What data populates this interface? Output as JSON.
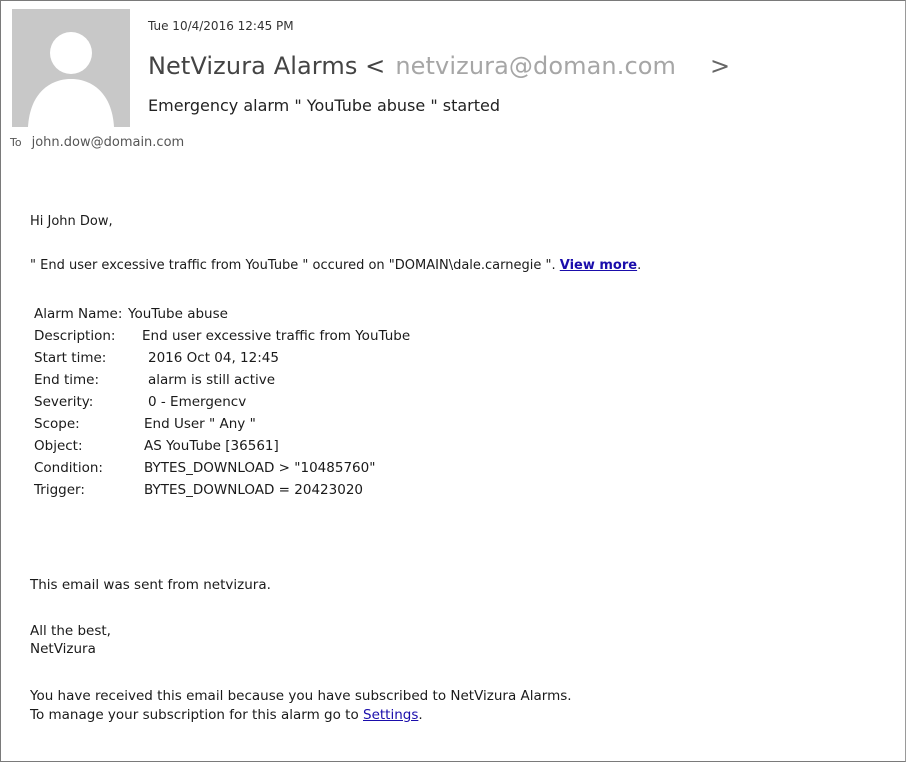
{
  "header": {
    "sent_time": "Tue 10/4/2016 12:45 PM",
    "sender_name": "NetVizura Alarms <",
    "sender_email": "netvizura@doman.com",
    "sender_close": ">",
    "subject": "Emergency alarm \" YouTube abuse \" started",
    "to_label": "To",
    "to_address": "john.dow@domain.com"
  },
  "body": {
    "greeting": "Hi John Dow,",
    "intro_quote": "\" End user excessive traffic from YouTube \"",
    "intro_middle": " occured on \"DOMAIN\\dale.carnegie \". ",
    "view_more": "View more",
    "intro_end": ".",
    "details": [
      {
        "key": "Alarm Name:",
        "value": "YouTube abuse"
      },
      {
        "key": "Description:",
        "value": "End user excessive traffic from YouTube"
      },
      {
        "key": "Start time:",
        "value": "2016 Oct 04, 12:45"
      },
      {
        "key": "End time:",
        "value": "alarm is still active"
      },
      {
        "key": "Severity:",
        "value": "0 - Emergencv"
      },
      {
        "key": "Scope:",
        "value": "End User \" Any \""
      },
      {
        "key": "Object:",
        "value": "AS YouTube [36561]"
      },
      {
        "key": "Condition:",
        "value": "BYTES_DOWNLOAD > \"10485760\""
      },
      {
        "key": "Trigger:",
        "value": "BYTES_DOWNLOAD = 20423020"
      }
    ],
    "sent_from": "This email was sent from netvizura.",
    "signoff_line1": "All the best,",
    "signoff_line2": "NetVizura",
    "footer_line1": "You have received this email because you have subscribed to NetVizura Alarms.",
    "footer_line2_prefix": "To manage your subscription for this alarm go to ",
    "settings_link": "Settings",
    "footer_line2_suffix": "."
  },
  "colors": {
    "link": "#1a0dab",
    "avatar_bg": "#c8c8c8",
    "email_grey": "#a6a6a6"
  },
  "icons": {
    "avatar": "person-silhouette-icon"
  }
}
